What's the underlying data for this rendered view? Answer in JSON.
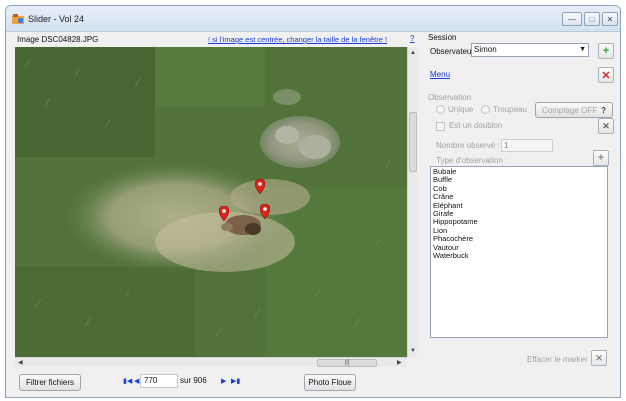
{
  "window": {
    "title": "Slider - Vol 24"
  },
  "image_panel": {
    "caption": "Image DSC04828.JPG",
    "hint": "! si l'image est centrée, changer la taille de la fenêtre !",
    "help": "?"
  },
  "bottom_bar": {
    "filter_label": "Filtrer fichiers",
    "page_value": "770",
    "page_total": "sur 906",
    "blur_label": "Photo Floue"
  },
  "session": {
    "group_label": "Session",
    "observer_label": "Observateur :",
    "observer_value": "Simon",
    "menu_link": "Menu"
  },
  "observation": {
    "group_label": "Observation",
    "radio_unique": "Unique",
    "radio_herd": "Troupeau",
    "count_button": "Comptage OFF",
    "count_help": "?",
    "duplicate_label": "Est un doublon",
    "count_label": "Nombre observé :",
    "count_value": "1",
    "type_label": "Type d'observation :",
    "types": [
      "Bubale",
      "Buffle",
      "Cob",
      "Crâne",
      "Eléphant",
      "Girafe",
      "Hippopotame",
      "Lion",
      "Phacochère",
      "Vautour",
      "Waterbuck"
    ],
    "clear_marker_label": "Effacer le marker"
  },
  "markers": {
    "count": 3,
    "color": "#d9251b"
  },
  "colors": {
    "link": "#1a3dd6",
    "add": "#2ea02e",
    "remove": "#d62a2a"
  }
}
